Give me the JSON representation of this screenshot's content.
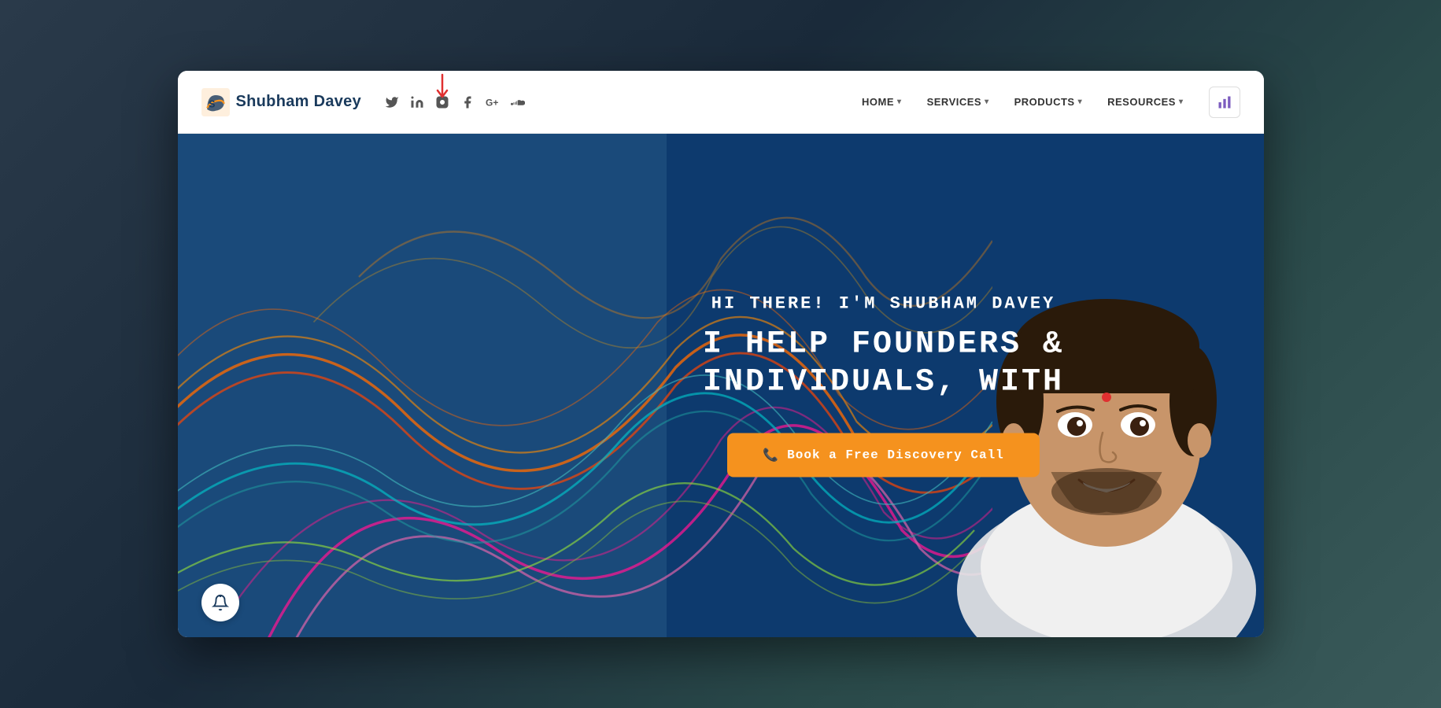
{
  "browser": {
    "title": "Shubham Davey"
  },
  "header": {
    "logo_text": "Shubham Davey",
    "social_icons": [
      "twitter",
      "linkedin",
      "instagram",
      "facebook",
      "google-plus",
      "soundcloud"
    ],
    "nav": [
      {
        "label": "HOME",
        "has_dropdown": true
      },
      {
        "label": "SERVICES",
        "has_dropdown": true
      },
      {
        "label": "PRODUCTS",
        "has_dropdown": true
      },
      {
        "label": "RESOURCES",
        "has_dropdown": true
      }
    ]
  },
  "hero": {
    "subtitle": "HI THERE! I'M SHUBHAM DAVEY",
    "title": "I HELP FOUNDERS & INDIVIDUALS, WITH",
    "cta_button": "Book a Free Discovery Call",
    "cta_phone_icon": "📞"
  },
  "colors": {
    "brand_blue": "#1a3a5c",
    "hero_bg": "#1a4a7a",
    "cta_orange": "#f5921e",
    "nav_text": "#333333"
  }
}
